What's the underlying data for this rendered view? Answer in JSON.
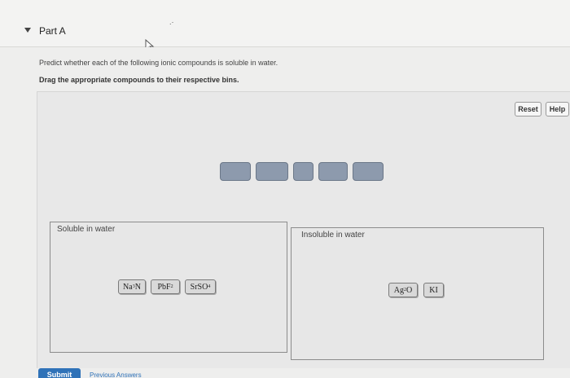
{
  "part": {
    "title": "Part A"
  },
  "instructions": {
    "line1": "Predict whether each of the following ionic compounds is soluble in water.",
    "line2": "Drag the appropriate compounds to their respective bins."
  },
  "toolbar": {
    "reset_label": "Reset",
    "help_label": "Help"
  },
  "bins": {
    "soluble": {
      "label": "Soluble in water",
      "items": [
        {
          "base": "Na",
          "sub1": "3",
          "rest": "N",
          "sub2": ""
        },
        {
          "base": "PbF",
          "sub1": "2",
          "rest": "",
          "sub2": ""
        },
        {
          "base": "SrSO",
          "sub1": "4",
          "rest": "",
          "sub2": ""
        }
      ]
    },
    "insoluble": {
      "label": "Insoluble in water",
      "items": [
        {
          "base": "Ag",
          "sub1": "2",
          "rest": "O",
          "sub2": ""
        },
        {
          "base": "KI",
          "sub1": "",
          "rest": "",
          "sub2": ""
        }
      ]
    }
  },
  "empty_slots_count": 5,
  "footer": {
    "submit_label": "Submit",
    "previous_label": "Previous Answers"
  },
  "colors": {
    "slot": "#8d9aad",
    "submit": "#2f72b8",
    "link": "#2f72b8"
  }
}
